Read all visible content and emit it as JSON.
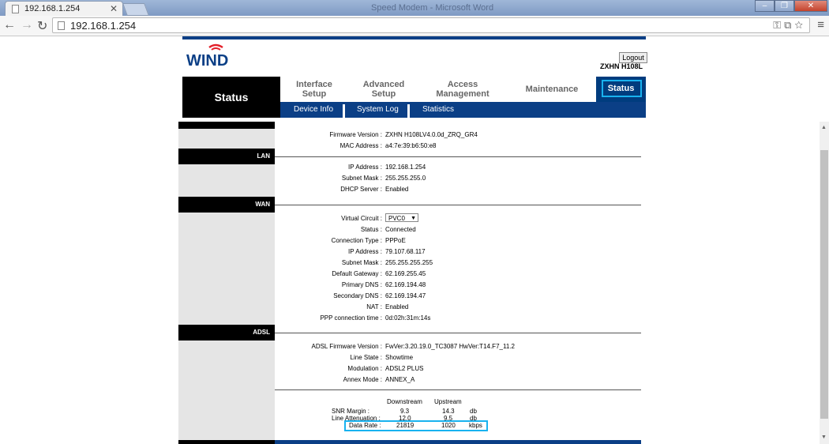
{
  "browser": {
    "tab_title": "192.168.1.254",
    "window_title": "Speed Modem - Microsoft Word",
    "url": "192.168.1.254"
  },
  "header": {
    "logo_text": "WIND",
    "logout_label": "Logout",
    "model": "ZXHN H108L"
  },
  "nav": {
    "status_title": "Status",
    "items": [
      {
        "label": "Interface\nSetup"
      },
      {
        "label": "Advanced\nSetup"
      },
      {
        "label": "Access\nManagement"
      },
      {
        "label": "Maintenance"
      },
      {
        "label": "Status"
      }
    ],
    "sub_items": [
      "Device Info",
      "System Log",
      "Statistics"
    ]
  },
  "device": {
    "firmware_label": "Firmware Version :",
    "firmware_value": "ZXHN H108LV4.0.0d_ZRQ_GR4",
    "mac_label": "MAC Address :",
    "mac_value": "a4:7e:39:b6:50:e8"
  },
  "lan": {
    "section": "LAN",
    "ip_label": "IP Address :",
    "ip_value": "192.168.1.254",
    "mask_label": "Subnet Mask :",
    "mask_value": "255.255.255.0",
    "dhcp_label": "DHCP Server :",
    "dhcp_value": "Enabled"
  },
  "wan": {
    "section": "WAN",
    "vc_label": "Virtual Circuit :",
    "vc_value": "PVC0",
    "status_label": "Status :",
    "status_value": "Connected",
    "conn_label": "Connection Type :",
    "conn_value": "PPPoE",
    "ip_label": "IP Address :",
    "ip_value": "79.107.68.117",
    "mask_label": "Subnet Mask :",
    "mask_value": "255.255.255.255",
    "gw_label": "Default Gateway :",
    "gw_value": "62.169.255.45",
    "pdns_label": "Primary DNS :",
    "pdns_value": "62.169.194.48",
    "sdns_label": "Secondary DNS :",
    "sdns_value": "62.169.194.47",
    "nat_label": "NAT :",
    "nat_value": "Enabled",
    "ppp_label": "PPP connection time :",
    "ppp_value": "0d:02h:31m:14s"
  },
  "adsl": {
    "section": "ADSL",
    "fw_label": "ADSL Firmware Version :",
    "fw_value": "FwVer:3.20.19.0_TC3087 HwVer:T14.F7_11.2",
    "ls_label": "Line State :",
    "ls_value": "Showtime",
    "mod_label": "Modulation :",
    "mod_value": "ADSL2 PLUS",
    "annex_label": "Annex Mode :",
    "annex_value": "ANNEX_A",
    "col_down": "Downstream",
    "col_up": "Upstream",
    "snr_label": "SNR Margin :",
    "snr_down": "9.3",
    "snr_up": "14.3",
    "snr_unit": "db",
    "att_label": "Line Attenuation :",
    "att_down": "12.0",
    "att_up": "9.5",
    "att_unit": "db",
    "rate_label": "Data Rate :",
    "rate_down": "21819",
    "rate_up": "1020",
    "rate_unit": "kbps"
  },
  "colors": {
    "accent": "#0b3f86",
    "highlight": "#19b2ef"
  }
}
